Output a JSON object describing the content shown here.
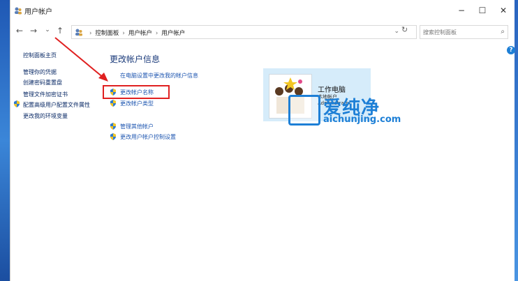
{
  "window": {
    "title": "用户帐户",
    "minimize": "−",
    "maximize": "☐",
    "close": "✕"
  },
  "nav": {
    "back": "←",
    "forward": "→",
    "dropdown": "⌄",
    "up": "↑"
  },
  "address": {
    "crumbs": [
      "控制面板",
      "用户帐户",
      "用户帐户"
    ],
    "dropdown": "⌄",
    "refresh": "↻"
  },
  "search": {
    "placeholder": "搜索控制面板",
    "icon": "⌕"
  },
  "sidebar": {
    "items": [
      {
        "label": "控制面板主页",
        "shield": false
      },
      {
        "label": "管理你的凭据",
        "shield": false
      },
      {
        "label": "创建密码重置盘",
        "shield": false
      },
      {
        "label": "管理文件加密证书",
        "shield": false
      },
      {
        "label": "配置高级用户配置文件属性",
        "shield": true
      },
      {
        "label": "更改我的环境变量",
        "shield": false
      }
    ]
  },
  "main": {
    "heading": "更改帐户信息",
    "links": [
      {
        "label": "在电脑设置中更改我的帐户信息",
        "shield": false
      },
      {
        "label": "更改帐户名称",
        "shield": true
      },
      {
        "label": "更改帐户类型",
        "shield": true
      },
      {
        "label": "管理其他帐户",
        "shield": true
      },
      {
        "label": "更改用户帐户控制设置",
        "shield": true
      }
    ]
  },
  "account": {
    "name": "工作电脑",
    "type": "本地帐户",
    "role": "Administrator"
  },
  "watermark": {
    "cn": "爱纯净",
    "url": "aichunjing.com"
  },
  "help": "?",
  "colors": {
    "highlight": "#e02020",
    "link": "#1e56b0",
    "card": "#d6ecfa",
    "watermark": "#1d7fd6"
  }
}
